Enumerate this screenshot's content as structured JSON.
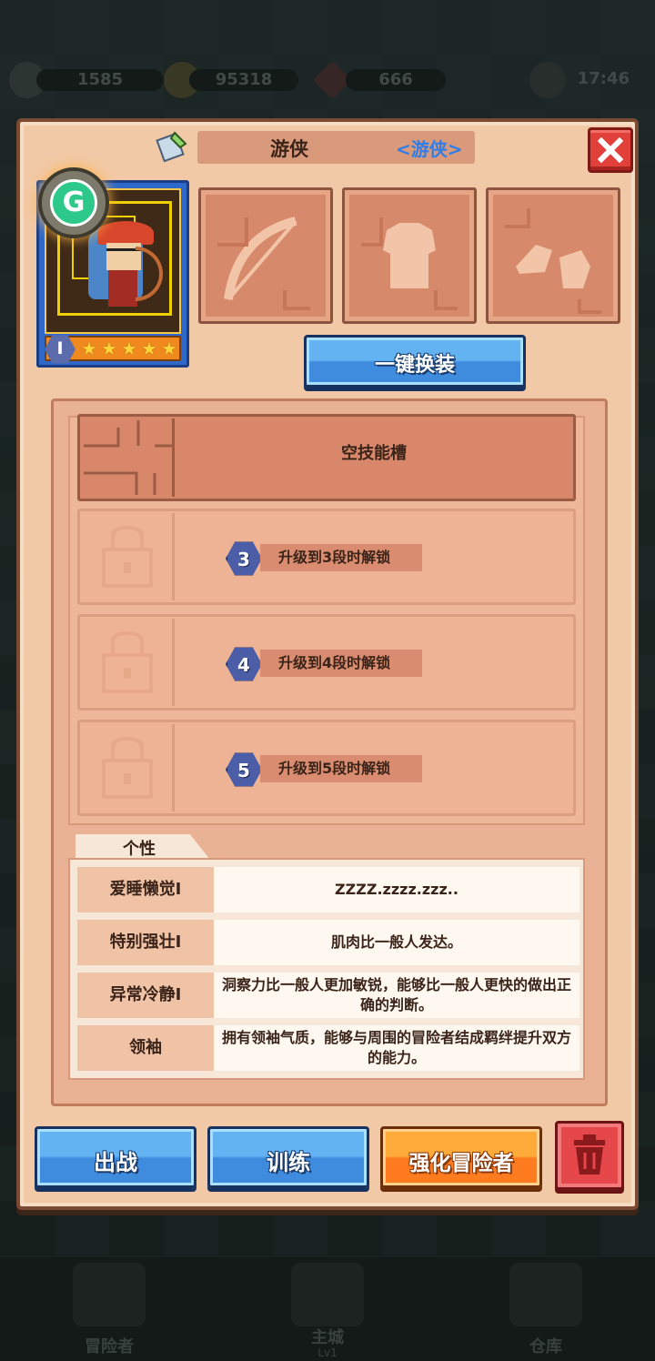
{
  "background": {
    "resources": [
      {
        "icon": "sword-icon",
        "value": "1585"
      },
      {
        "icon": "coin-icon",
        "value": "95318"
      },
      {
        "icon": "gem-icon",
        "value": "666"
      }
    ],
    "clock": "17:46",
    "nav": [
      {
        "label": "冒险者",
        "sub": ""
      },
      {
        "label": "主城",
        "sub": "Lv1"
      },
      {
        "label": "仓库",
        "sub": ""
      }
    ]
  },
  "dialog": {
    "title": "游侠",
    "subtitle": "<游侠>",
    "hero": {
      "rank": "I",
      "stars": 5,
      "badge_letter": "G"
    },
    "equipment": [
      {
        "icon": "bow-icon"
      },
      {
        "icon": "armor-icon"
      },
      {
        "icon": "boots-icon"
      }
    ],
    "one_key_equip": "一键换装",
    "skills": {
      "empty_slot": "空技能槽",
      "locked": [
        {
          "level": "3",
          "text": "升级到3段时解锁"
        },
        {
          "level": "4",
          "text": "升级到4段时解锁"
        },
        {
          "level": "5",
          "text": "升级到5段时解锁"
        }
      ]
    },
    "traits_label": "个性",
    "traits": [
      {
        "name": "爱睡懒觉I",
        "desc": "ZZZZ.zzzz.zzz.."
      },
      {
        "name": "特别强壮I",
        "desc": "肌肉比一般人发达。"
      },
      {
        "name": "异常冷静I",
        "desc": "洞察力比一般人更加敏锐，能够比一般人更快的做出正确的判断。"
      },
      {
        "name": "领袖",
        "desc": "拥有领袖气质，能够与周围的冒险者结成羁绊提升双方的能力。"
      }
    ],
    "buttons": {
      "deploy": "出战",
      "train": "训练",
      "enhance": "强化冒险者"
    }
  },
  "colors": {
    "panel": "#f2c9a6",
    "blue_button": "#3f8bde",
    "orange_button": "#ff7b1f",
    "close_red": "#e2413b",
    "subtitle_blue": "#2f7de8"
  }
}
